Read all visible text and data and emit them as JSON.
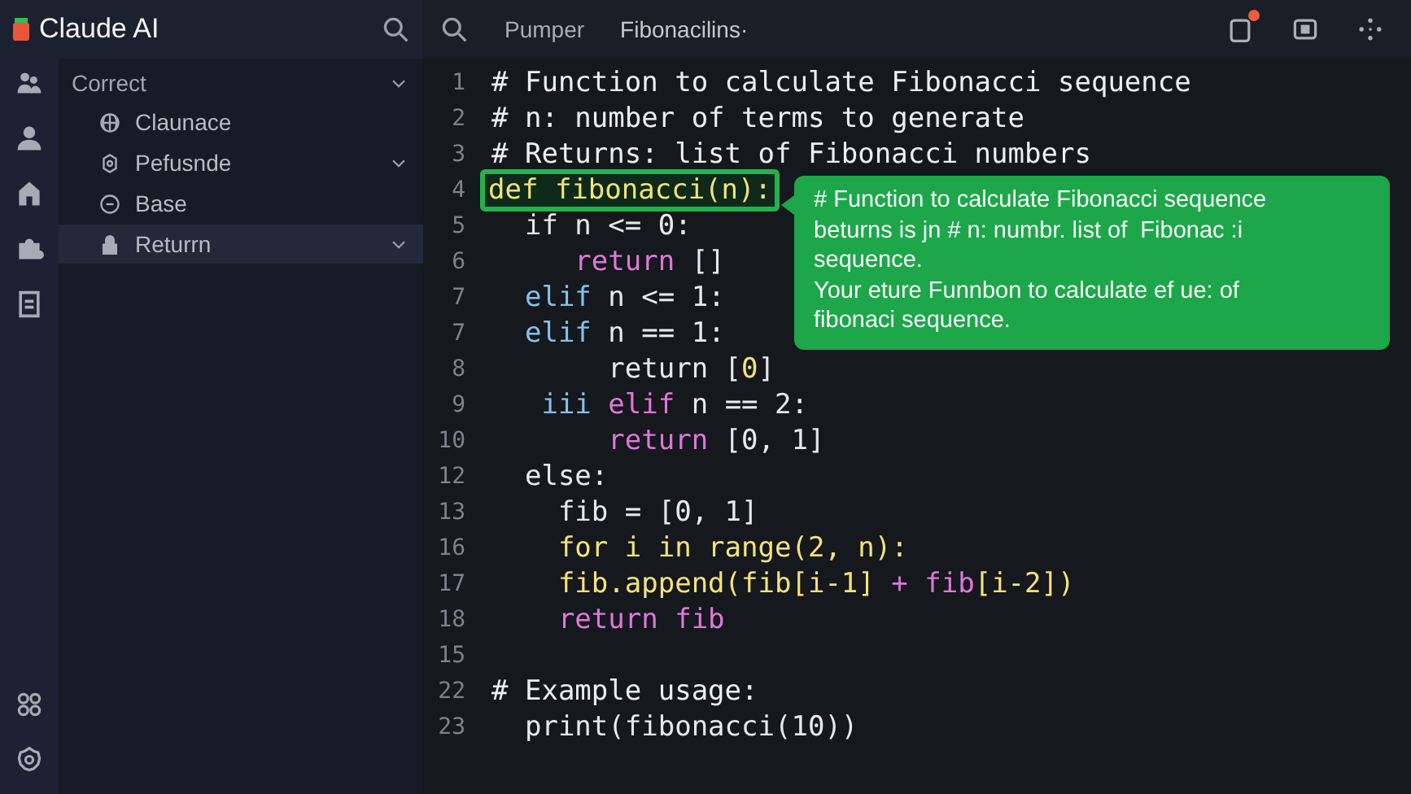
{
  "app": {
    "title": "Claude AI"
  },
  "sidebar": {
    "header": {
      "label": "Correct",
      "expandable": true
    },
    "items": [
      {
        "label": "Claunace",
        "expandable": false,
        "selected": false
      },
      {
        "label": "Pefusnde",
        "expandable": true,
        "selected": false
      },
      {
        "label": "Base",
        "expandable": false,
        "selected": false
      },
      {
        "label": "Returrn",
        "expandable": true,
        "selected": true
      }
    ]
  },
  "editor": {
    "tabs": [
      {
        "label": "Pumper",
        "selected": false
      },
      {
        "label": "Fibonacilins·",
        "selected": true
      }
    ],
    "notification": true,
    "lines": [
      {
        "number": "1",
        "tokens": [
          {
            "text": "# Function to calculate Fibonacci sequence",
            "kind": "comment"
          }
        ]
      },
      {
        "number": "2",
        "tokens": [
          {
            "text": "# n: number of terms to generate",
            "kind": "comment"
          }
        ]
      },
      {
        "number": "3",
        "tokens": [
          {
            "text": "# Returns: list of Fibonacci numbers",
            "kind": "comment"
          }
        ]
      },
      {
        "number": "4",
        "highlighted": true,
        "tokens": [
          {
            "text": "def fibonacci(n):",
            "kind": "def"
          }
        ]
      },
      {
        "number": "5",
        "tokens": [
          {
            "text": "  if n <= 0:",
            "kind": "plain"
          }
        ]
      },
      {
        "number": "6",
        "tokens": [
          {
            "text": "     return",
            "kind": "keyword"
          },
          {
            "text": " []",
            "kind": "plain"
          }
        ]
      },
      {
        "number": "7",
        "tokens": [
          {
            "text": "  elif",
            "kind": "branch"
          },
          {
            "text": " n <= 1:",
            "kind": "plain"
          }
        ]
      },
      {
        "number": "7",
        "tokens": [
          {
            "text": "  elif",
            "kind": "branch"
          },
          {
            "text": " n == 1:",
            "kind": "plain"
          }
        ]
      },
      {
        "number": "8",
        "tokens": [
          {
            "text": "       return [",
            "kind": "plain"
          },
          {
            "text": "0",
            "kind": "number"
          },
          {
            "text": "]",
            "kind": "plain"
          }
        ]
      },
      {
        "number": "9",
        "tokens": [
          {
            "text": "   iii",
            "kind": "branch"
          },
          {
            "text": " elif",
            "kind": "keyword"
          },
          {
            "text": " n == 2:",
            "kind": "plain"
          }
        ]
      },
      {
        "number": "10",
        "tokens": [
          {
            "text": "       return",
            "kind": "keyword"
          },
          {
            "text": " [0, 1]",
            "kind": "plain"
          }
        ]
      },
      {
        "number": "12",
        "tokens": [
          {
            "text": "  else:",
            "kind": "plain"
          }
        ]
      },
      {
        "number": "13",
        "tokens": [
          {
            "text": "    fib = [0, 1]",
            "kind": "plain"
          }
        ]
      },
      {
        "number": "16",
        "tokens": [
          {
            "text": "    for i in range(2, n):",
            "kind": "def"
          }
        ]
      },
      {
        "number": "17",
        "tokens": [
          {
            "text": "    fib.append(fib[i-1]",
            "kind": "def"
          },
          {
            "text": " + fib",
            "kind": "keyword"
          },
          {
            "text": "[i-2])",
            "kind": "def"
          }
        ]
      },
      {
        "number": "18",
        "tokens": [
          {
            "text": "    return fib",
            "kind": "keyword"
          }
        ]
      },
      {
        "number": "15"
      },
      {
        "number": "22",
        "tokens": [
          {
            "text": "# Example usage:",
            "kind": "comment"
          }
        ]
      },
      {
        "number": "23",
        "tokens": [
          {
            "text": "  print(fibonacci(10))",
            "kind": "plain"
          }
        ]
      }
    ],
    "tooltip": {
      "lines": [
        "# Function to calculate Fibonacci sequence",
        "beturns is jn # n: numbr. list of  Fibonac :i",
        "sequence.",
        "Your eture Funnbon to calculate ef ue: of",
        "fibonaci sequence."
      ]
    }
  }
}
